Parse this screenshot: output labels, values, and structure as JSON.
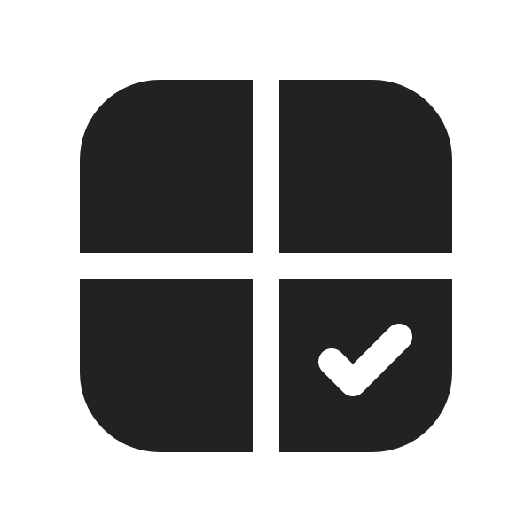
{
  "icon": {
    "name": "grid-checkmark-icon",
    "color": "#222222",
    "background": "#ffffff",
    "checkmark_color": "#ffffff"
  }
}
